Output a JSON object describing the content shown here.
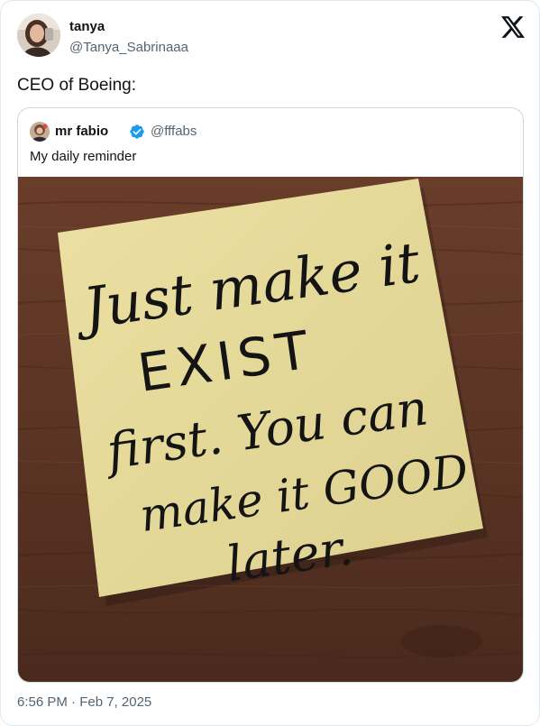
{
  "tweet": {
    "author_name": "tanya",
    "author_handle": "@Tanya_Sabrinaaa",
    "text": "CEO of Boeing:",
    "timestamp": "6:56 PM · Feb 7, 2025"
  },
  "quoted_tweet": {
    "author_name": "mr fabio",
    "author_handle": "@fffabs",
    "verified": true,
    "text": "My daily reminder",
    "photo": {
      "note_lines": [
        "Just make it",
        "EXIST",
        "first. You can",
        "make it GOOD",
        "later."
      ]
    }
  },
  "icons": {
    "brand": "x-logo-icon",
    "verified": "verified-badge-icon"
  },
  "colors": {
    "text": "#0f1419",
    "secondary_text": "#536471",
    "verified_blue": "#1d9bf0",
    "border": "#cfd9de",
    "sticky_note": "#e8dc9a",
    "wood": "#5b3424"
  }
}
